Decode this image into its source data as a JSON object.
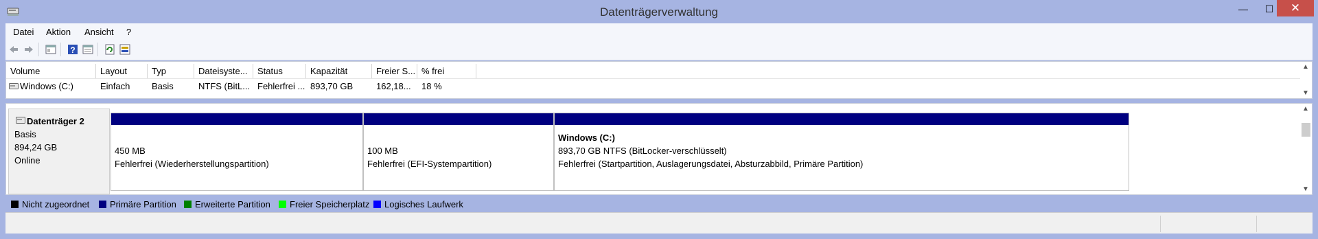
{
  "window": {
    "title": "Datenträgerverwaltung",
    "min_glyph": "—",
    "max_glyph": "☐",
    "close_glyph": "✕"
  },
  "menu": [
    "Datei",
    "Aktion",
    "Ansicht",
    "?"
  ],
  "toolbar_icons": [
    "back-arrow-icon",
    "forward-arrow-icon",
    "console-tree-icon",
    "help-icon",
    "properties-icon",
    "refresh-icon",
    "rescan-disks-icon"
  ],
  "volume_table": {
    "columns": [
      "Volume",
      "Layout",
      "Typ",
      "Dateisyste...",
      "Status",
      "Kapazität",
      "Freier S...",
      "% frei"
    ],
    "rows": [
      [
        "Windows (C:)",
        "Einfach",
        "Basis",
        "NTFS (BitL...",
        "Fehlerfrei ...",
        "893,70 GB",
        "162,18...",
        "18 %"
      ]
    ]
  },
  "disk": {
    "name": "Datenträger 2",
    "type": "Basis",
    "size": "894,24 GB",
    "state": "Online",
    "partitions": [
      {
        "title": "",
        "line1": "450 MB",
        "line2": "Fehlerfrei (Wiederherstellungspartition)"
      },
      {
        "title": "",
        "line1": "100 MB",
        "line2": "Fehlerfrei (EFI-Systempartition)"
      },
      {
        "title": "Windows  (C:)",
        "line1": "893,70 GB NTFS (BitLocker-verschlüsselt)",
        "line2": "Fehlerfrei (Startpartition, Auslagerungsdatei, Absturzabbild, Primäre Partition)"
      }
    ]
  },
  "legend": [
    {
      "label": "Nicht zugeordnet",
      "color": "#000000"
    },
    {
      "label": "Primäre Partition",
      "color": "#000080"
    },
    {
      "label": "Erweiterte Partition",
      "color": "#008000"
    },
    {
      "label": "Freier Speicherplatz",
      "color": "#00ff00"
    },
    {
      "label": "Logisches Laufwerk",
      "color": "#0000ff"
    }
  ],
  "colors": {
    "titlebar": "#a6b4e2",
    "close_button": "#c7504a",
    "partition_bar": "#000080"
  }
}
